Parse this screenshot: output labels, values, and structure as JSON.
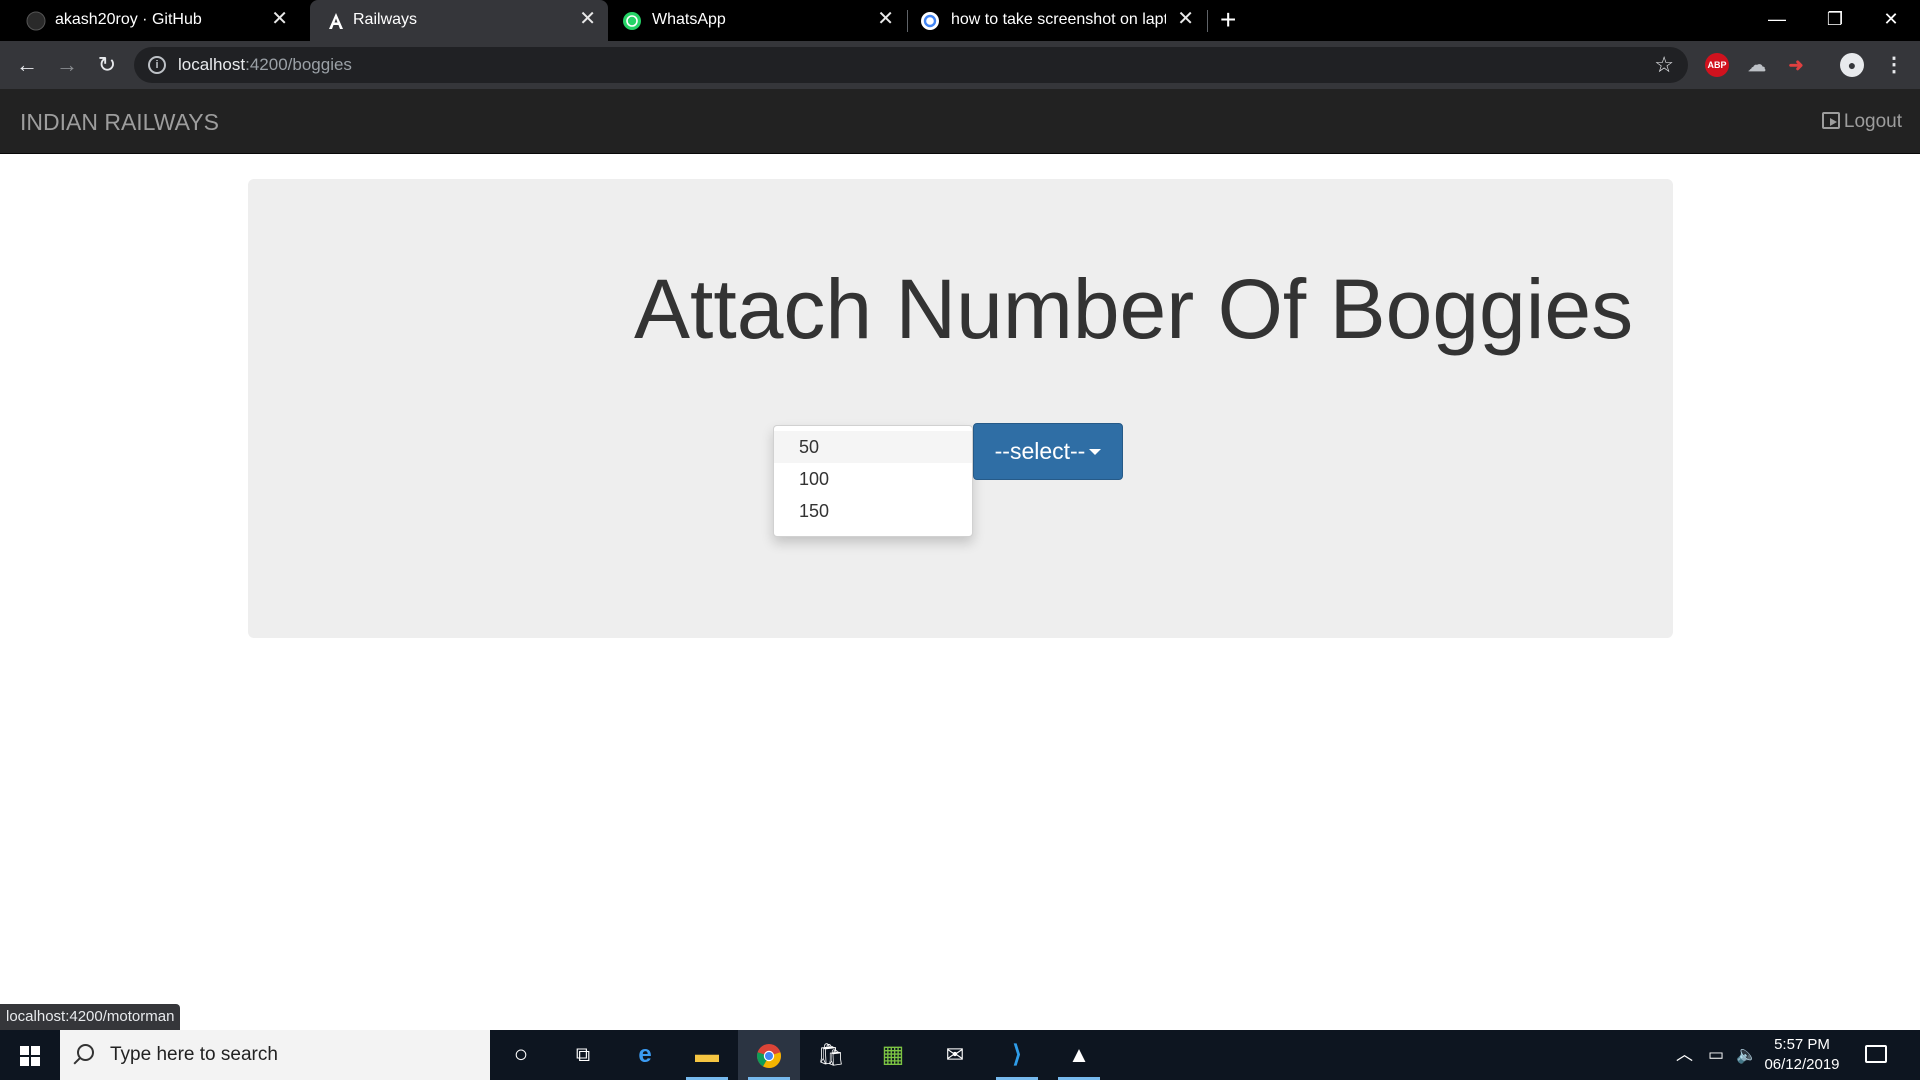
{
  "browser": {
    "tabs": [
      {
        "title": "akash20roy · GitHub",
        "icon": "github-icon",
        "close": "✕"
      },
      {
        "title": "Railways",
        "icon": "angular-icon",
        "close": "✕"
      },
      {
        "title": "WhatsApp",
        "icon": "whatsapp-icon",
        "close": "✕"
      },
      {
        "title": "how to take screenshot on laptop",
        "icon": "google-icon",
        "close": "✕"
      }
    ],
    "new_tab": "+",
    "window_controls": {
      "minimize": "—",
      "restore": "❐",
      "close": "✕"
    },
    "url": {
      "host": "localhost",
      "rest": ":4200/boggies"
    },
    "extensions": {
      "abp": "ABP"
    }
  },
  "app": {
    "brand": "INDIAN RAILWAYS",
    "logout": "Logout",
    "heading": "Attach Number Of Boggies",
    "dropdown_options": [
      "50",
      "100",
      "150"
    ],
    "select_button": "--select--"
  },
  "status_url": "localhost:4200/motorman",
  "taskbar": {
    "search_placeholder": "Type here to search",
    "time": "5:57 PM",
    "date": "06/12/2019"
  },
  "colors": {
    "navbar": "#222222",
    "jumbotron": "#eeeeee",
    "primary_button": "#2f6ea5",
    "taskbar": "#0d1520"
  }
}
